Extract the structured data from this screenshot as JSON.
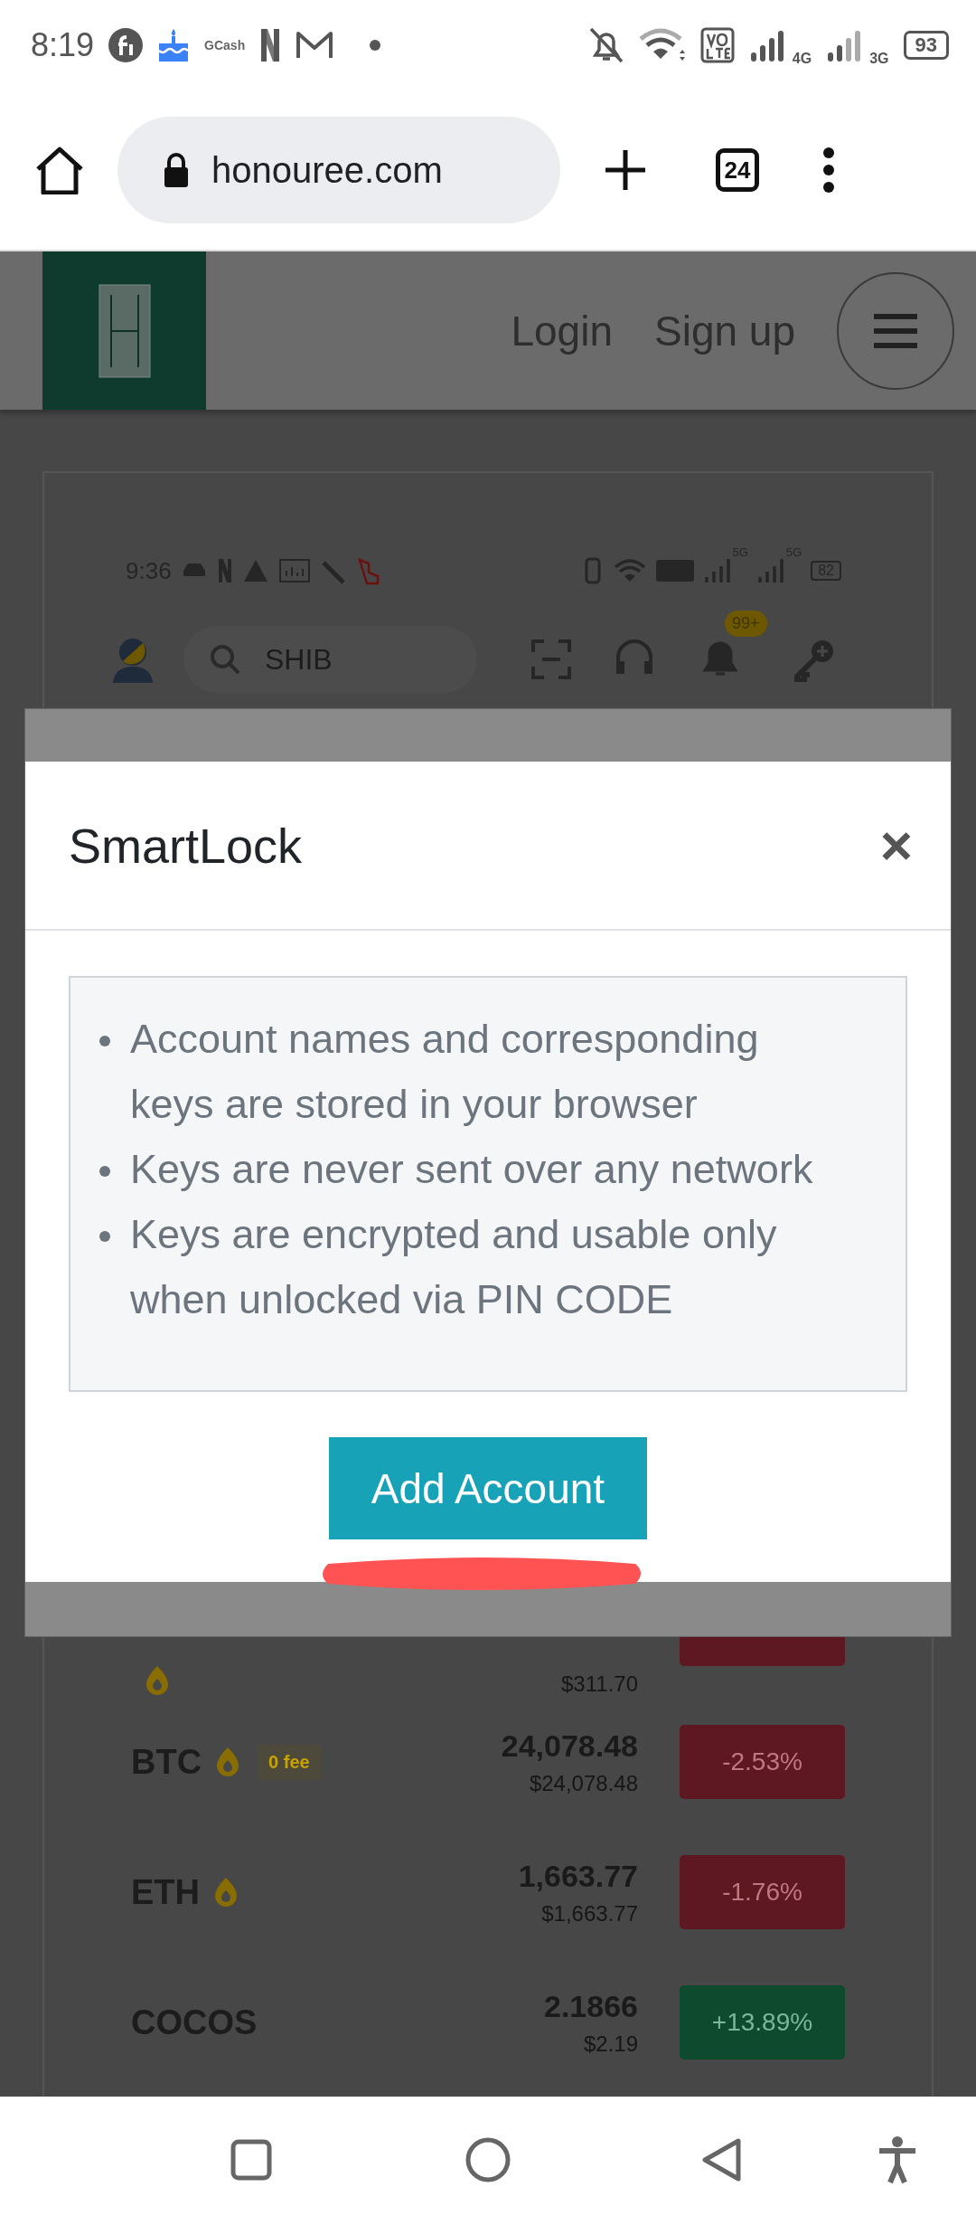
{
  "status_bar": {
    "time": "8:19",
    "app_label": "GCash",
    "network_1": "4G",
    "network_2": "3G",
    "battery": "93"
  },
  "browser": {
    "url": "honouree.com",
    "tab_count": "24"
  },
  "site_header": {
    "nav": [
      "Login",
      "Sign up"
    ]
  },
  "embedded_screenshot": {
    "time": "9:36",
    "network_1": "5G",
    "network_2": "5G",
    "battery": "82",
    "search_placeholder": "SHIB",
    "badge": "99+"
  },
  "market_rows": [
    {
      "hot": true,
      "usd": "$311.70",
      "positive": false
    },
    {
      "symbol": "BTC",
      "hot": true,
      "tag": "0 fee",
      "price": "24,078.48",
      "usd": "$24,078.48",
      "change": "-2.53%",
      "positive": false
    },
    {
      "symbol": "ETH",
      "hot": true,
      "price": "1,663.77",
      "usd": "$1,663.77",
      "change": "-1.76%",
      "positive": false
    },
    {
      "symbol": "COCOS",
      "hot": false,
      "price": "2.1866",
      "usd": "$2.19",
      "change": "+13.89%",
      "positive": true
    }
  ],
  "modal": {
    "title": "SmartLock",
    "close": "×",
    "bullets": [
      "Account names and corresponding keys are stored in your browser",
      "Keys are never sent over any network",
      "Keys are encrypted and usable only when unlocked via PIN CODE"
    ],
    "button": "Add Account"
  }
}
